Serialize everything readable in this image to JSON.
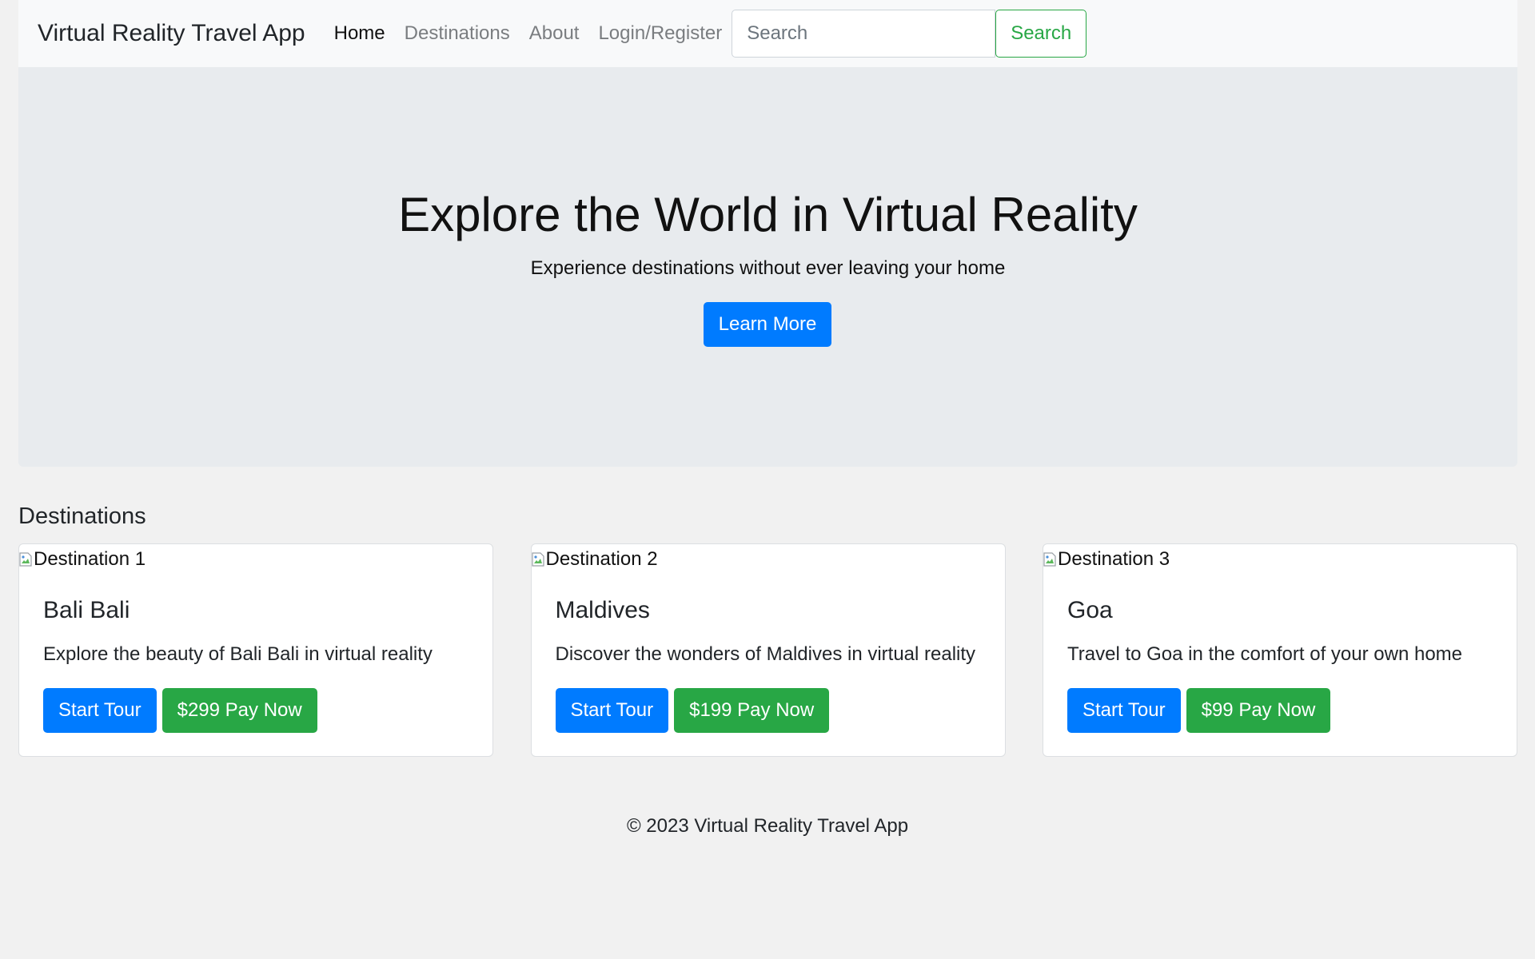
{
  "navbar": {
    "brand": "Virtual Reality Travel App",
    "links": [
      {
        "label": "Home",
        "active": true
      },
      {
        "label": "Destinations",
        "active": false
      },
      {
        "label": "About",
        "active": false
      },
      {
        "label": "Login/Register",
        "active": false
      }
    ],
    "search": {
      "placeholder": "Search",
      "button_label": "Search"
    }
  },
  "hero": {
    "title": "Explore the World in Virtual Reality",
    "subtitle": "Experience destinations without ever leaving your home",
    "button_label": "Learn More"
  },
  "destinations": {
    "heading": "Destinations",
    "cards": [
      {
        "image_alt": "Destination 1",
        "title": "Bali Bali",
        "text": "Explore the beauty of Bali Bali in virtual reality",
        "tour_label": "Start Tour",
        "pay_label": "$299 Pay Now"
      },
      {
        "image_alt": "Destination 2",
        "title": "Maldives",
        "text": "Discover the wonders of Maldives in virtual reality",
        "tour_label": "Start Tour",
        "pay_label": "$199 Pay Now"
      },
      {
        "image_alt": "Destination 3",
        "title": "Goa",
        "text": "Travel to Goa in the comfort of your own home",
        "tour_label": "Start Tour",
        "pay_label": "$99 Pay Now"
      }
    ]
  },
  "footer": {
    "text": "© 2023 Virtual Reality Travel App"
  },
  "colors": {
    "primary": "#007bff",
    "success": "#28a745",
    "navbar_bg": "#f8f9fa",
    "hero_bg": "#e8ebee",
    "page_bg": "#f1f1f1"
  },
  "icons": {
    "card_image": "broken-image-icon"
  }
}
